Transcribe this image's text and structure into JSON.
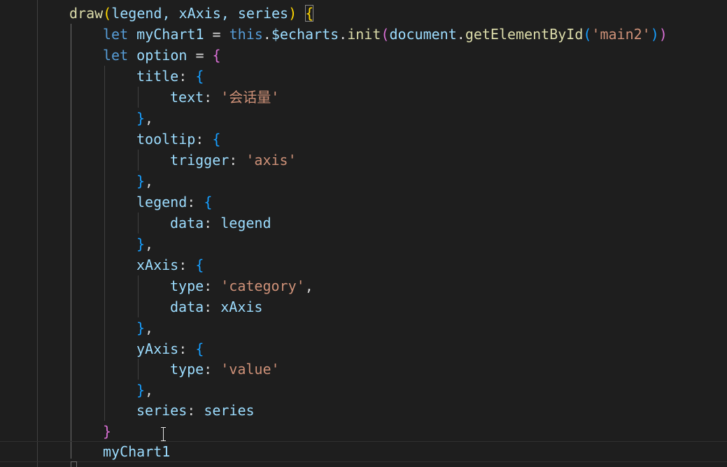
{
  "editor": {
    "lines": {
      "l1": {
        "fn": "draw",
        "open_paren": "(",
        "params": "legend, xAxis, series",
        "close_paren": ")",
        "brace": "{"
      },
      "l2": {
        "kw": "let",
        "var": "myChart1",
        "eq": " = ",
        "this": "this",
        "dot1": ".",
        "echarts": "$echarts",
        "dot2": ".",
        "init": "init",
        "p1": "(",
        "document": "document",
        "dot3": ".",
        "getById": "getElementById",
        "p2": "(",
        "arg": "'main2'",
        "p3": ")",
        "p4": ")"
      },
      "l3": {
        "kw": "let",
        "var": "option",
        "eq": " = ",
        "brace": "{"
      },
      "l4": {
        "key": "title",
        "colon": ": ",
        "brace": "{"
      },
      "l5": {
        "key": "text",
        "colon": ": ",
        "value": "'会话量'"
      },
      "l6": {
        "brace": "}",
        "comma": ","
      },
      "l7": {
        "key": "tooltip",
        "colon": ": ",
        "brace": "{"
      },
      "l8": {
        "key": "trigger",
        "colon": ": ",
        "value": "'axis'"
      },
      "l9": {
        "brace": "}",
        "comma": ","
      },
      "l10": {
        "key": "legend",
        "colon": ": ",
        "brace": "{"
      },
      "l11": {
        "key": "data",
        "colon": ": ",
        "value": "legend"
      },
      "l12": {
        "brace": "}",
        "comma": ","
      },
      "l13": {
        "key": "xAxis",
        "colon": ": ",
        "brace": "{"
      },
      "l14": {
        "key": "type",
        "colon": ": ",
        "value": "'category'",
        "comma": ","
      },
      "l15": {
        "key": "data",
        "colon": ": ",
        "value": "xAxis"
      },
      "l16": {
        "brace": "}",
        "comma": ","
      },
      "l17": {
        "key": "yAxis",
        "colon": ": ",
        "brace": "{"
      },
      "l18": {
        "key": "type",
        "colon": ": ",
        "value": "'value'"
      },
      "l19": {
        "brace": "}",
        "comma": ","
      },
      "l20": {
        "key": "series",
        "colon": ": ",
        "value": "series"
      },
      "l21": {
        "brace": "}"
      },
      "l22": {
        "var": "myChart1"
      }
    },
    "colors": {
      "background": "#1e1e1e",
      "function": "#dcdcaa",
      "variable": "#9cdcfe",
      "keyword": "#569cd6",
      "string": "#ce9178",
      "bracket_level1": "#ffd700",
      "bracket_level2": "#da70d6",
      "bracket_level3": "#179fff"
    },
    "icons": [
      "text-cursor-icon",
      "fold-marker-icon"
    ]
  }
}
